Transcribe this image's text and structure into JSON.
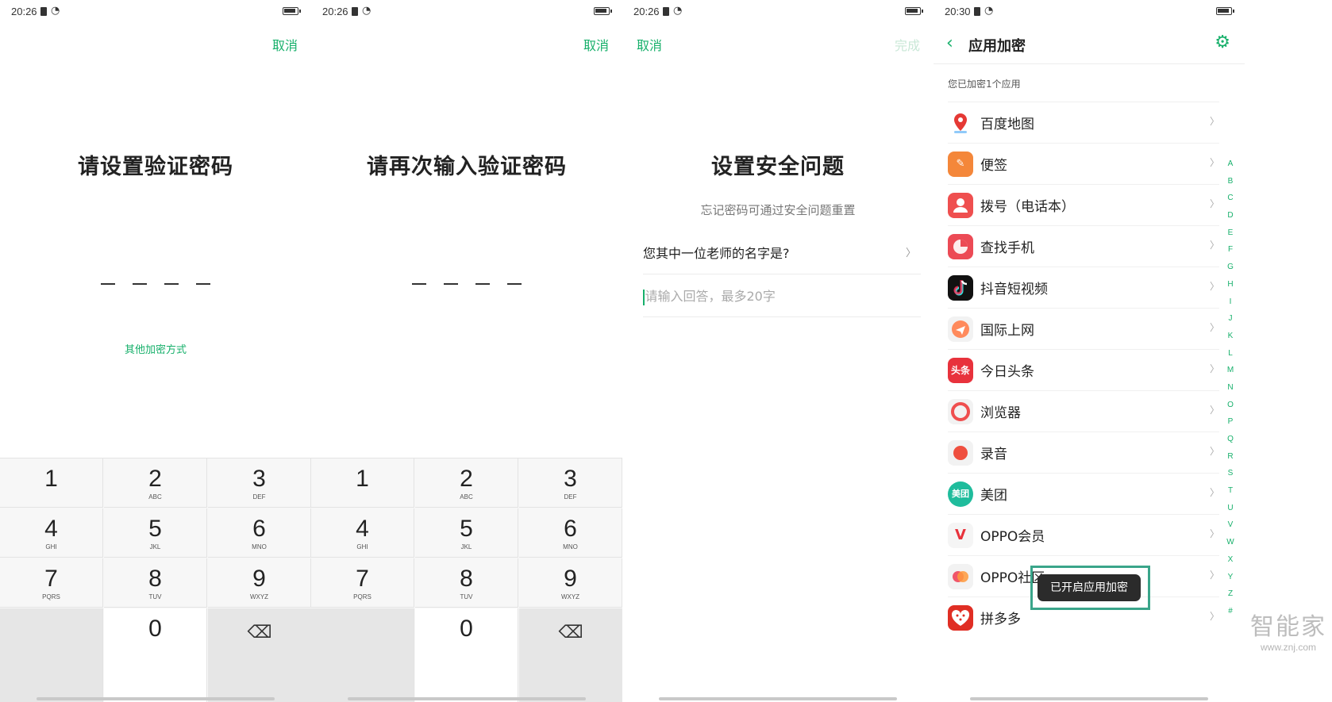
{
  "colors": {
    "accent": "#17b06b",
    "keypad_bg": "#f7f7f7",
    "toast_bg": "#2b2b2b",
    "highlight_frame": "#3aa58a"
  },
  "screen1": {
    "time": "20:26",
    "cancel": "取消",
    "title": "请设置验证密码",
    "other_method": "其他加密方式"
  },
  "screen2": {
    "time": "20:26",
    "cancel": "取消",
    "title": "请再次输入验证密码"
  },
  "keypad": [
    {
      "num": "1",
      "letters": ""
    },
    {
      "num": "2",
      "letters": "ABC"
    },
    {
      "num": "3",
      "letters": "DEF"
    },
    {
      "num": "4",
      "letters": "GHI"
    },
    {
      "num": "5",
      "letters": "JKL"
    },
    {
      "num": "6",
      "letters": "MNO"
    },
    {
      "num": "7",
      "letters": "PQRS"
    },
    {
      "num": "8",
      "letters": "TUV"
    },
    {
      "num": "9",
      "letters": "WXYZ"
    },
    {
      "num": "0",
      "letters": ""
    }
  ],
  "screen3": {
    "time": "20:26",
    "cancel": "取消",
    "done": "完成",
    "title": "设置安全问题",
    "hint": "忘记密码可通过安全问题重置",
    "question": "您其中一位老师的名字是?",
    "answer_placeholder": "请输入回答，最多20字"
  },
  "screen4": {
    "time": "20:30",
    "title": "应用加密",
    "summary": "您已加密1个应用",
    "apps": [
      {
        "name": "百度地图",
        "icon": "baidu-map-icon"
      },
      {
        "name": "便签",
        "icon": "notes-icon"
      },
      {
        "name": "拨号（电话本）",
        "icon": "dialer-icon"
      },
      {
        "name": "查找手机",
        "icon": "find-phone-icon"
      },
      {
        "name": "抖音短视频",
        "icon": "douyin-icon"
      },
      {
        "name": "国际上网",
        "icon": "global-internet-icon"
      },
      {
        "name": "今日头条",
        "icon": "toutiao-icon",
        "badge": "头条"
      },
      {
        "name": "浏览器",
        "icon": "browser-icon"
      },
      {
        "name": "录音",
        "icon": "recorder-icon"
      },
      {
        "name": "美团",
        "icon": "meituan-icon",
        "badge": "美团"
      },
      {
        "name": "OPPO会员",
        "icon": "oppo-member-icon",
        "badge": "V"
      },
      {
        "name": "OPPO社区",
        "icon": "oppo-community-icon"
      },
      {
        "name": "拼多多",
        "icon": "pinduoduo-icon"
      }
    ],
    "alphabet": [
      "A",
      "B",
      "C",
      "D",
      "E",
      "F",
      "G",
      "H",
      "I",
      "J",
      "K",
      "L",
      "M",
      "N",
      "O",
      "P",
      "Q",
      "R",
      "S",
      "T",
      "U",
      "V",
      "W",
      "X",
      "Y",
      "Z",
      "#"
    ],
    "toast": "已开启应用加密"
  },
  "watermark": {
    "brand": "智能家",
    "url": "www.znj.com"
  }
}
